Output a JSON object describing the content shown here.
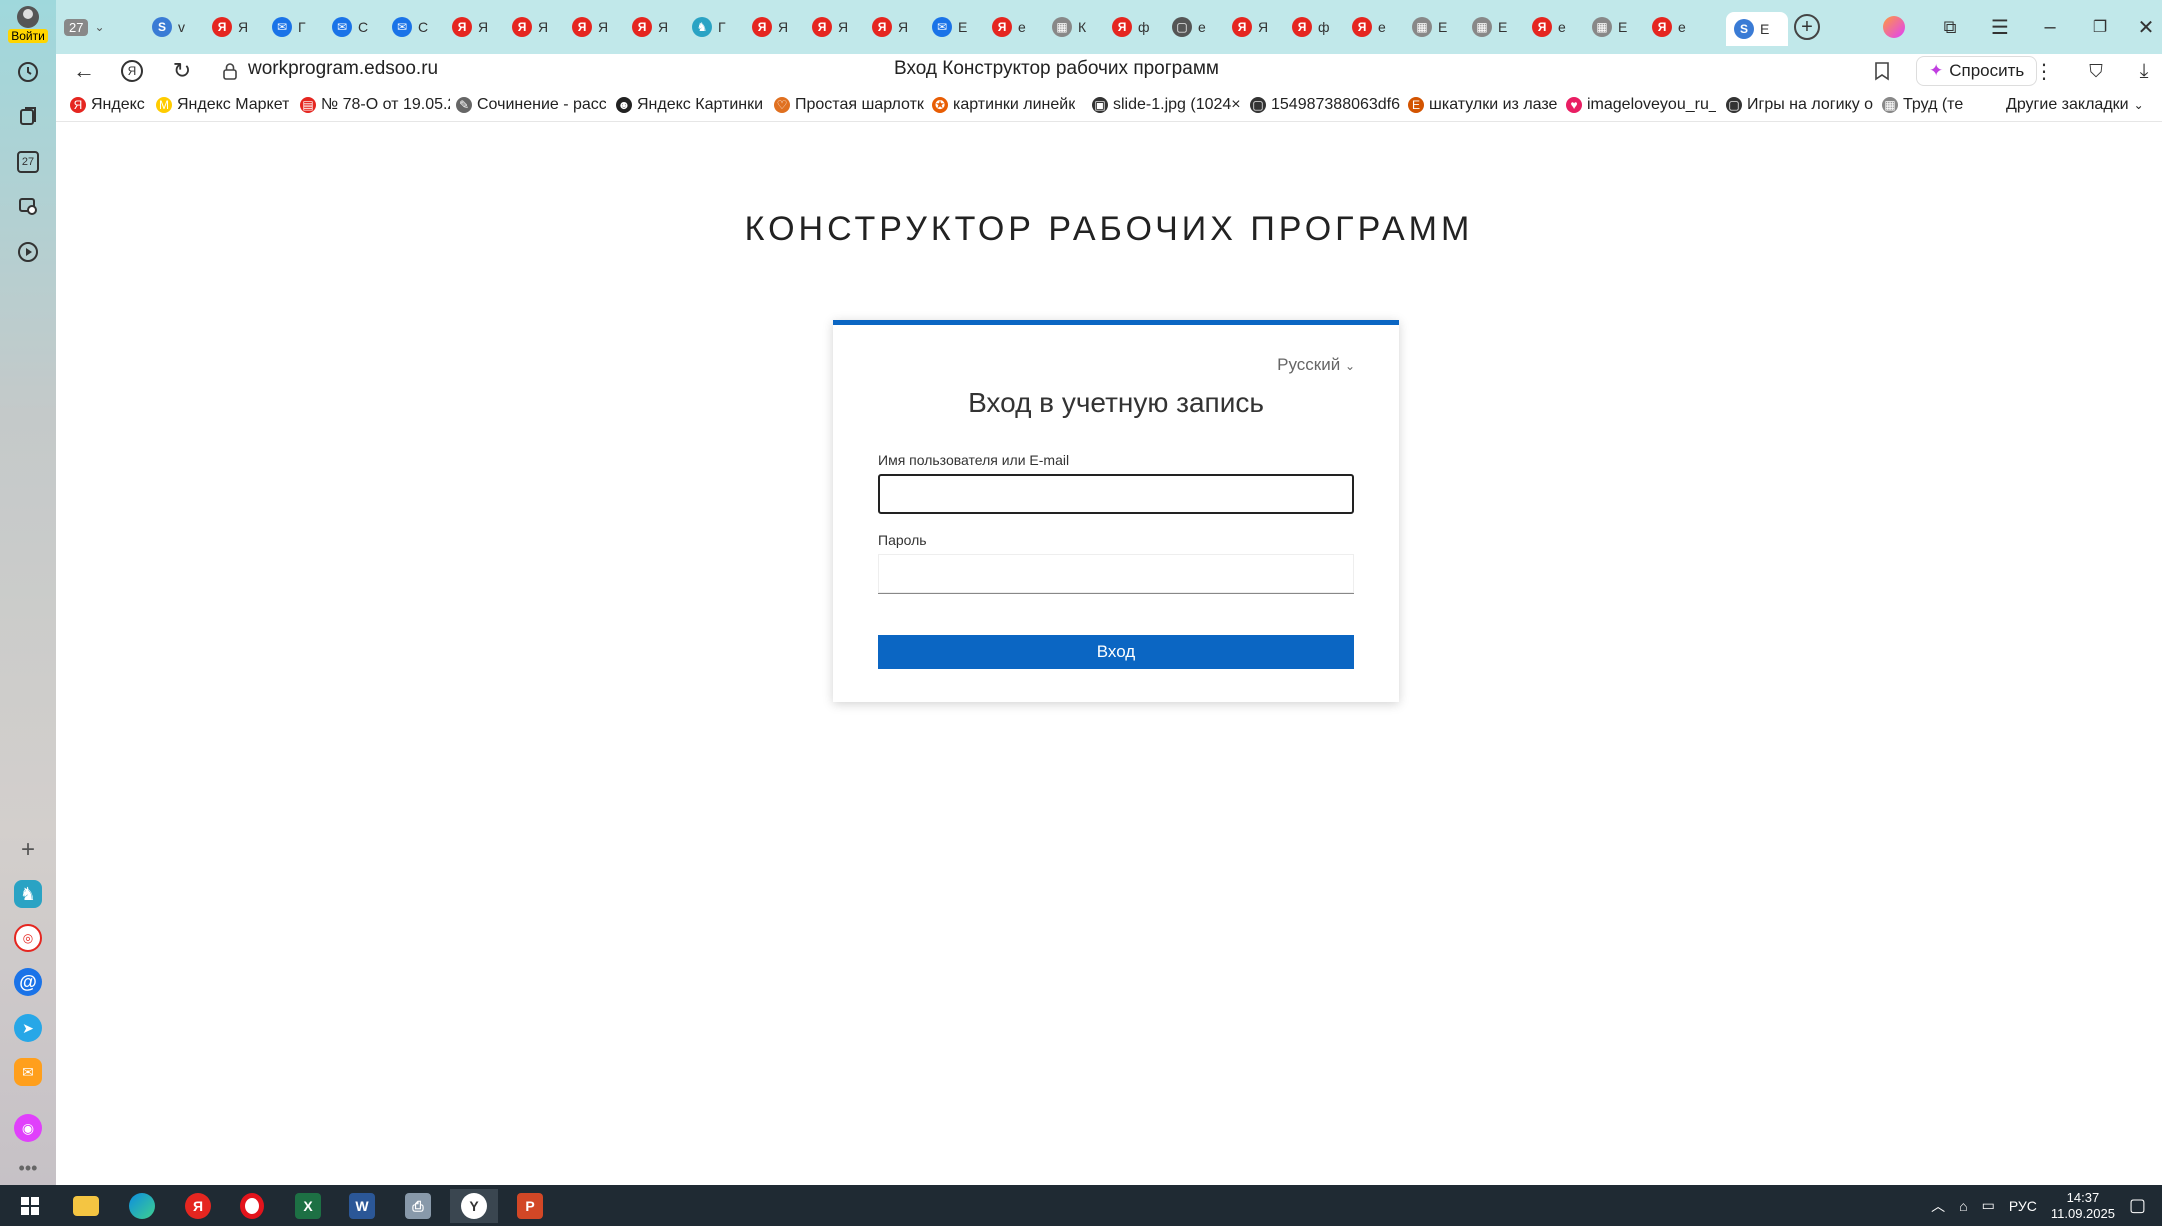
{
  "sidebar": {
    "login_label": "Войти",
    "calendar_day": "27"
  },
  "tabs": {
    "counter_tab": "27",
    "items": [
      {
        "letter": "v",
        "color": "#3a7bd5",
        "fav": "S"
      },
      {
        "letter": "Я",
        "color": "#e52620",
        "fav": "Я"
      },
      {
        "letter": "Г",
        "color": "#1a73e8",
        "fav": "✉"
      },
      {
        "letter": "С",
        "color": "#1a73e8",
        "fav": "✉"
      },
      {
        "letter": "С",
        "color": "#1a73e8",
        "fav": "✉"
      },
      {
        "letter": "Я",
        "color": "#e52620",
        "fav": "Я"
      },
      {
        "letter": "Я",
        "color": "#e52620",
        "fav": "Я"
      },
      {
        "letter": "Я",
        "color": "#e52620",
        "fav": "Я"
      },
      {
        "letter": "Я",
        "color": "#e52620",
        "fav": "Я"
      },
      {
        "letter": "Г",
        "color": "#2aa3c4",
        "fav": "♞"
      },
      {
        "letter": "Я",
        "color": "#e52620",
        "fav": "Я"
      },
      {
        "letter": "Я",
        "color": "#e52620",
        "fav": "Я"
      },
      {
        "letter": "Я",
        "color": "#e52620",
        "fav": "Я"
      },
      {
        "letter": "Е",
        "color": "#1a73e8",
        "fav": "✉"
      },
      {
        "letter": "е",
        "color": "#e52620",
        "fav": "Я"
      },
      {
        "letter": "К",
        "color": "#888888",
        "fav": "▦"
      },
      {
        "letter": "ф",
        "color": "#e52620",
        "fav": "Я"
      },
      {
        "letter": "е",
        "color": "#555555",
        "fav": "▢"
      },
      {
        "letter": "Я",
        "color": "#e52620",
        "fav": "Я"
      },
      {
        "letter": "ф",
        "color": "#e52620",
        "fav": "Я"
      },
      {
        "letter": "е",
        "color": "#e52620",
        "fav": "Я"
      },
      {
        "letter": "Е",
        "color": "#888888",
        "fav": "▦"
      },
      {
        "letter": "Е",
        "color": "#888888",
        "fav": "▦"
      },
      {
        "letter": "е",
        "color": "#e52620",
        "fav": "Я"
      },
      {
        "letter": "Е",
        "color": "#888888",
        "fav": "▦"
      },
      {
        "letter": "е",
        "color": "#e52620",
        "fav": "Я"
      }
    ],
    "active": {
      "letter": "Е",
      "color": "#3a7bd5",
      "fav": "S"
    }
  },
  "toolbar": {
    "url": "workprogram.edsoo.ru",
    "page_title": "Вход Конструктор рабочих программ",
    "ask_label": "Спросить"
  },
  "bookmarks": [
    {
      "label": "Яндекс",
      "color": "#e52620",
      "icon": "Я"
    },
    {
      "label": "Яндекс Маркет",
      "color": "#ffcc00",
      "icon": "M"
    },
    {
      "label": "№ 78-О от 19.05.2",
      "color": "#e52620",
      "icon": "▤"
    },
    {
      "label": "Сочинение - расс",
      "color": "#666666",
      "icon": "✎"
    },
    {
      "label": "Яндекс Картинки",
      "color": "#222222",
      "icon": "☻"
    },
    {
      "label": "Простая шарлотк",
      "color": "#e07020",
      "icon": "♡"
    },
    {
      "label": "картинки линейк",
      "color": "#e85d04",
      "icon": "✪"
    },
    {
      "label": "slide-1.jpg (1024×",
      "color": "#333333",
      "icon": "▣"
    },
    {
      "label": "154987388063df6",
      "color": "#333333",
      "icon": "▢"
    },
    {
      "label": "шкатулки из лазе",
      "color": "#d35400",
      "icon": "E"
    },
    {
      "label": "imageloveyou_ru_",
      "color": "#e91e63",
      "icon": "♥"
    },
    {
      "label": "Игры на логику о",
      "color": "#333333",
      "icon": "▢"
    },
    {
      "label": "Труд (те",
      "color": "#888888",
      "icon": "▦"
    }
  ],
  "bookmarks_other": "Другие закладки",
  "page": {
    "heading": "КОНСТРУКТОР РАБОЧИХ ПРОГРАММ",
    "language": "Русский",
    "card_title": "Вход в учетную запись",
    "username_label": "Имя пользователя или E-mail",
    "username_value": "",
    "password_label": "Пароль",
    "password_value": "",
    "submit_label": "Вход"
  },
  "taskbar": {
    "lang": "РУС",
    "time": "14:37",
    "date": "11.09.2025"
  }
}
